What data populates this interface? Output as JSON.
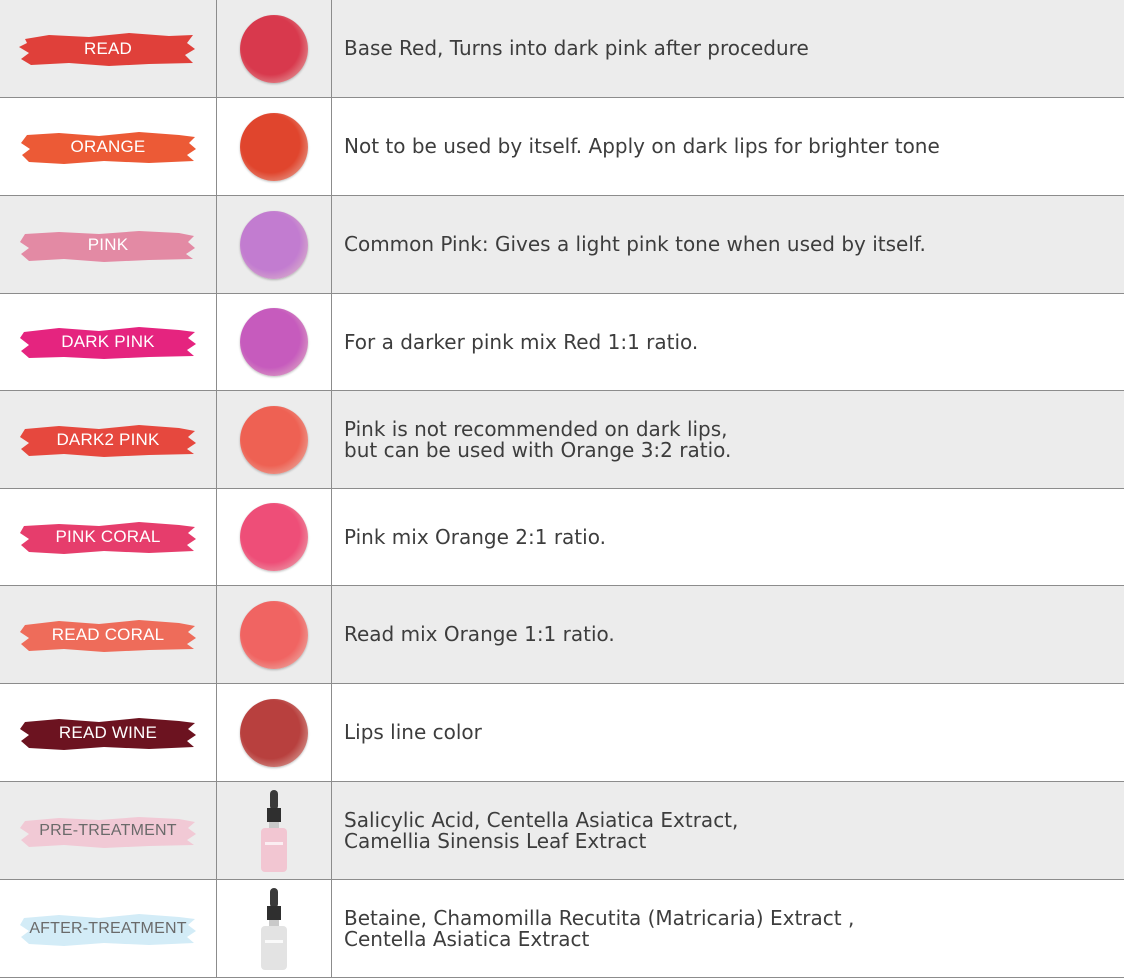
{
  "rows": [
    {
      "label": "READ",
      "brush_color": "#e0403a",
      "swatch_color": "#d8394d",
      "description": [
        "Base Red, Turns into dark pink after procedure"
      ]
    },
    {
      "label": "ORANGE",
      "brush_color": "#ec5a36",
      "swatch_color": "#e0452d",
      "description": [
        "Not to be used by itself. Apply on dark lips for brighter tone"
      ]
    },
    {
      "label": "PINK",
      "brush_color": "#e38aa4",
      "swatch_color": "#c27cd0",
      "description": [
        "Common Pink: Gives a light pink tone when used by itself."
      ]
    },
    {
      "label": "DARK PINK",
      "brush_color": "#e5247f",
      "swatch_color": "#c65bbd",
      "description": [
        "For a darker pink mix Red  1:1 ratio."
      ]
    },
    {
      "label": "DARK2 PINK",
      "brush_color": "#e6483e",
      "swatch_color": "#ee6153",
      "description": [
        "Pink is not recommended on dark lips,",
        "but can be used with Orange 3:2 ratio."
      ]
    },
    {
      "label": "PINK CORAL",
      "brush_color": "#e63d6c",
      "swatch_color": "#ee4e78",
      "description": [
        "Pink mix Orange  2:1 ratio."
      ]
    },
    {
      "label": "READ CORAL",
      "brush_color": "#ee6c5a",
      "swatch_color": "#f06462",
      "description": [
        "Read mix Orange  1:1 ratio."
      ]
    },
    {
      "label": "READ WINE",
      "brush_color": "#6c1320",
      "swatch_color": "#b8403e",
      "description": [
        "Lips line color"
      ]
    },
    {
      "label": "PRE-TREATMENT",
      "brush_color": "#f1c9d5",
      "bottle_color": "#f2c6d2",
      "description": [
        "Salicylic Acid, Centella Asiatica Extract,",
        "Camellia Sinensis Leaf Extract"
      ]
    },
    {
      "label": "AFTER-TREATMENT",
      "brush_color": "#d3ecf7",
      "bottle_color": "#e3e3e3",
      "description": [
        "Betaine, Chamomilla Recutita (Matricaria) Extract ,",
        "Centella Asiatica Extract"
      ]
    }
  ]
}
